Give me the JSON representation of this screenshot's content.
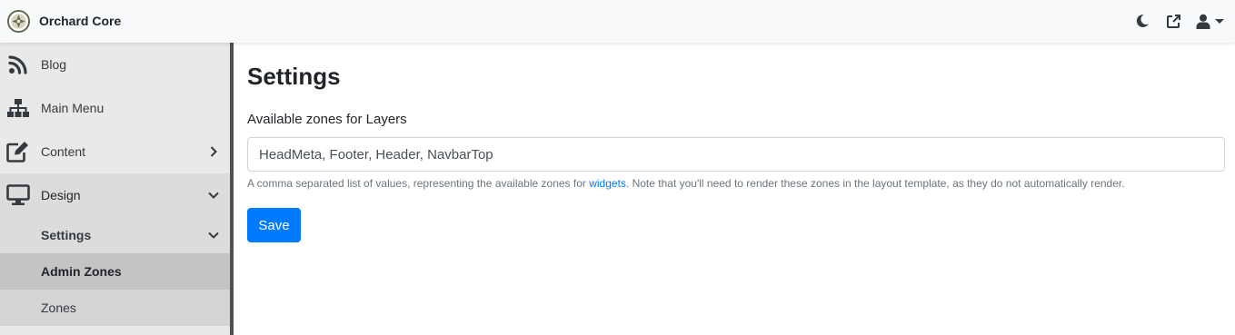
{
  "app": {
    "brand_title": "Orchard Core",
    "logo_icon": "orchard-core-logo",
    "accent_color": "#007bff"
  },
  "topbar": {
    "icons": [
      "moon-icon",
      "external-link-icon",
      "user-icon"
    ]
  },
  "sidebar": {
    "items": [
      {
        "label": "Blog",
        "icon": "rss-icon"
      },
      {
        "label": "Main Menu",
        "icon": "sitemap-icon"
      },
      {
        "label": "Content",
        "icon": "edit-icon",
        "chevron": "right"
      },
      {
        "label": "Design",
        "icon": "desktop-icon",
        "chevron": "down",
        "active": true
      }
    ],
    "subitems": [
      {
        "label": "Settings",
        "chevron": "down"
      },
      {
        "label": "Admin Zones",
        "selected": true
      },
      {
        "label": "Zones"
      }
    ]
  },
  "main": {
    "title": "Settings",
    "field_label": "Available zones for Layers",
    "field_value": "HeadMeta, Footer, Header, NavbarTop",
    "help_prefix": "A comma separated list of values, representing the available zones for ",
    "help_link": "widgets",
    "help_suffix": ". Note that you'll need to render these zones in the layout template, as they do not automatically render.",
    "save_label": "Save"
  }
}
